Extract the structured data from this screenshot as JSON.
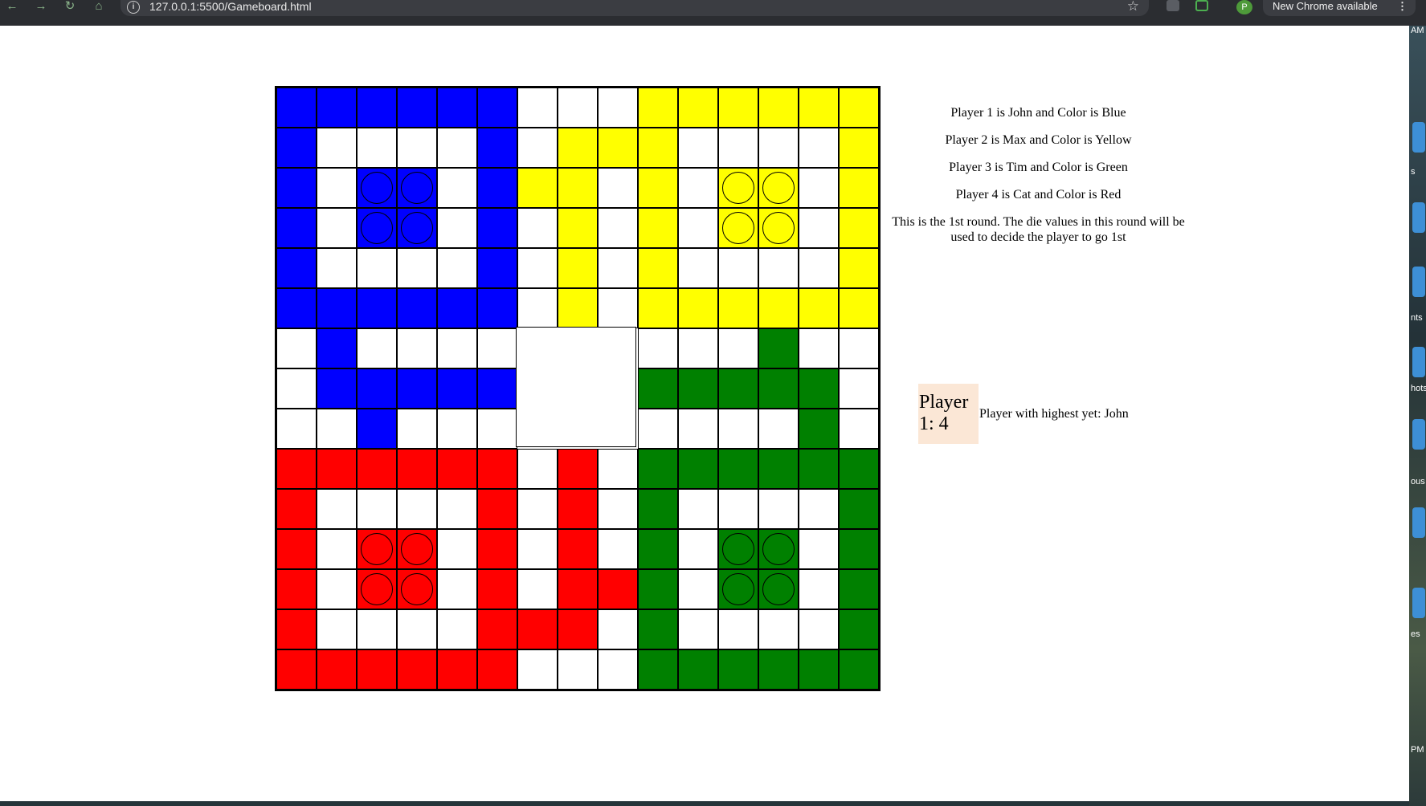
{
  "browser": {
    "url": "127.0.0.1:5500/Gameboard.html",
    "profile_initial": "P",
    "update_label": "New Chrome available",
    "menu_glyph": "⋮",
    "star_glyph": "☆",
    "info_glyph": "i",
    "back_glyph": "←",
    "forward_glyph": "→",
    "reload_glyph": "↻",
    "home_glyph": "⌂"
  },
  "desktop_strip": {
    "labels": [
      "AM",
      "s",
      "nts",
      "hots",
      "ous",
      "es",
      "PM"
    ]
  },
  "board": {
    "colors": {
      "W": "#ffffff",
      "B": "#0000ff",
      "Y": "#ffff00",
      "G": "#008000",
      "R": "#ff0000"
    },
    "rows": [
      "BBBBBBWWWYYYYYY",
      "BWWWWBWYYYWWWWY",
      "BWBBWBYYWYWYYWY",
      "BWBBWBWYWYWYYWY",
      "BWWWWBWYWYWWWWY",
      "BBBBBBWYWYYYYYY",
      "WBWWWW...WWWGWW",
      "WBBBBB...GGGGGW",
      "WWBWWW...WWWWGW",
      "RRRRRRWRWGGGGGG",
      "RWWWWRWRWGWWWWG",
      "RWRRWRWRWGWGGWG",
      "RWRRWRWRRGWGGWG",
      "RWWWWRRRWGWWWWG",
      "RRRRRRWWWGGGGGG"
    ],
    "pieces": [
      {
        "row": 2,
        "col": 2
      },
      {
        "row": 2,
        "col": 3
      },
      {
        "row": 3,
        "col": 2
      },
      {
        "row": 3,
        "col": 3
      },
      {
        "row": 2,
        "col": 11
      },
      {
        "row": 2,
        "col": 12
      },
      {
        "row": 3,
        "col": 11
      },
      {
        "row": 3,
        "col": 12
      },
      {
        "row": 11,
        "col": 2
      },
      {
        "row": 11,
        "col": 3
      },
      {
        "row": 12,
        "col": 2
      },
      {
        "row": 12,
        "col": 3
      },
      {
        "row": 11,
        "col": 11
      },
      {
        "row": 11,
        "col": 12
      },
      {
        "row": 12,
        "col": 11
      },
      {
        "row": 12,
        "col": 12
      }
    ]
  },
  "info": {
    "players": [
      "Player 1 is John and Color is Blue",
      "Player 2 is Max and Color is Yellow",
      "Player 3 is Tim and Color is Green",
      "Player 4 is Cat and Color is Red"
    ],
    "round_note": "This is the 1st round. The die values in this round will be used to decide the player to go 1st"
  },
  "die_result": {
    "label": "Player 1: 4",
    "highest": "Player with highest yet: John"
  }
}
